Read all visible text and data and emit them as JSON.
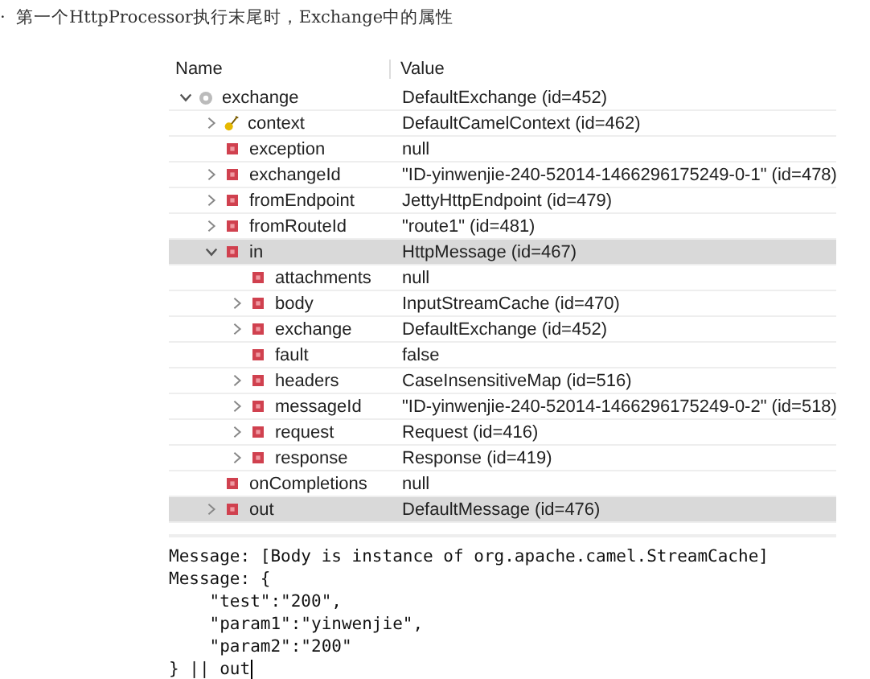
{
  "caption": {
    "bullet": "·",
    "text": "第一个HttpProcessor执行末尾时，Exchange中的属性"
  },
  "variables": {
    "columns": [
      "Name",
      "Value"
    ],
    "rows": [
      {
        "name": "exchange",
        "value": "DefaultExchange  (id=452)",
        "kind": "object",
        "expanded": true,
        "selected": false,
        "children": [
          {
            "name": "context",
            "value": "DefaultCamelContext  (id=462)",
            "kind": "static",
            "expanded": false,
            "selected": false
          },
          {
            "name": "exception",
            "value": "null",
            "kind": "field",
            "selected": false
          },
          {
            "name": "exchangeId",
            "value": "\"ID-yinwenjie-240-52014-1466296175249-0-1\" (id=478)",
            "kind": "field",
            "expanded": false,
            "selected": false
          },
          {
            "name": "fromEndpoint",
            "value": "JettyHttpEndpoint  (id=479)",
            "kind": "field",
            "expanded": false,
            "selected": false
          },
          {
            "name": "fromRouteId",
            "value": "\"route1\" (id=481)",
            "kind": "field",
            "expanded": false,
            "selected": false
          },
          {
            "name": "in",
            "value": "HttpMessage  (id=467)",
            "kind": "field",
            "expanded": true,
            "selected": true,
            "children": [
              {
                "name": "attachments",
                "value": "null",
                "kind": "field",
                "selected": false
              },
              {
                "name": "body",
                "value": "InputStreamCache  (id=470)",
                "kind": "field",
                "expanded": false,
                "selected": false
              },
              {
                "name": "exchange",
                "value": "DefaultExchange  (id=452)",
                "kind": "field",
                "expanded": false,
                "selected": false
              },
              {
                "name": "fault",
                "value": "false",
                "kind": "field",
                "selected": false
              },
              {
                "name": "headers",
                "value": "CaseInsensitiveMap  (id=516)",
                "kind": "field",
                "expanded": false,
                "selected": false
              },
              {
                "name": "messageId",
                "value": "\"ID-yinwenjie-240-52014-1466296175249-0-2\" (id=518)",
                "kind": "field",
                "expanded": false,
                "selected": false
              },
              {
                "name": "request",
                "value": "Request  (id=416)",
                "kind": "field",
                "expanded": false,
                "selected": false
              },
              {
                "name": "response",
                "value": "Response  (id=419)",
                "kind": "field",
                "expanded": false,
                "selected": false
              }
            ]
          },
          {
            "name": "onCompletions",
            "value": "null",
            "kind": "field",
            "selected": false
          },
          {
            "name": "out",
            "value": "DefaultMessage  (id=476)",
            "kind": "field",
            "expanded": false,
            "selected": true
          }
        ]
      }
    ]
  },
  "detail": {
    "lines": [
      "Message: [Body is instance of org.apache.camel.StreamCache]",
      "Message: {",
      "    \"test\":\"200\",",
      "    \"param1\":\"yinwenjie\",",
      "    \"param2\":\"200\"",
      "} || out"
    ]
  }
}
